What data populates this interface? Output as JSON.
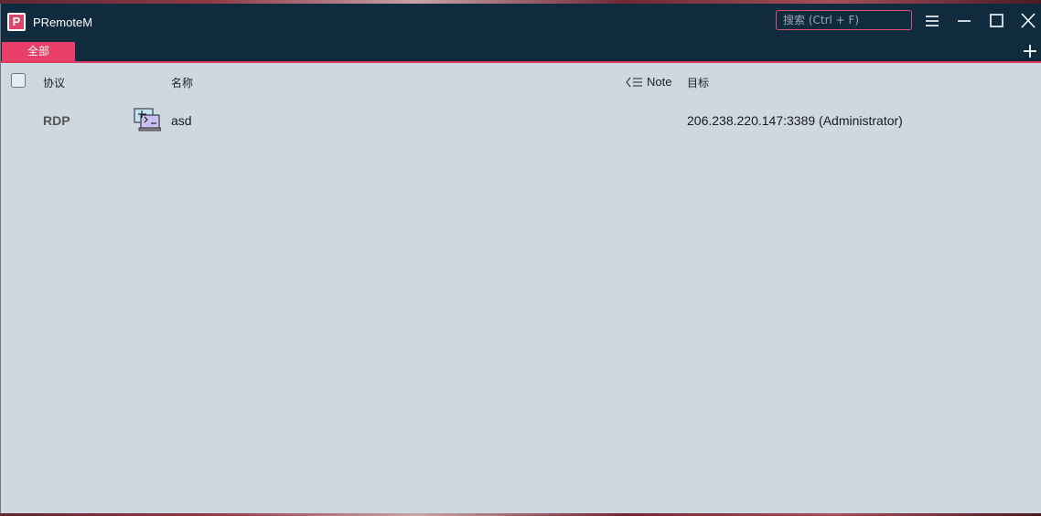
{
  "window": {
    "title": "PRemoteM",
    "logo_letter": "P"
  },
  "search": {
    "placeholder": "搜索 (Ctrl + F)"
  },
  "controls": {
    "menu_icon": "hamburger-icon",
    "minimize_icon": "minimize-icon",
    "maximize_icon": "maximize-icon",
    "close_icon": "close-icon"
  },
  "tabs": [
    {
      "label": "全部",
      "active": true
    }
  ],
  "columns": {
    "protocol": "协议",
    "name": "名称",
    "note": "Note",
    "target": "目标"
  },
  "rows": [
    {
      "protocol": "RDP",
      "icon": "rdp-computer-icon",
      "name": "asd",
      "target": "206.238.220.147:3389 (Administrator)"
    }
  ],
  "colors": {
    "titlebar": "#102a3e",
    "accent": "#e83e68",
    "content_bg": "#ced8e1"
  }
}
